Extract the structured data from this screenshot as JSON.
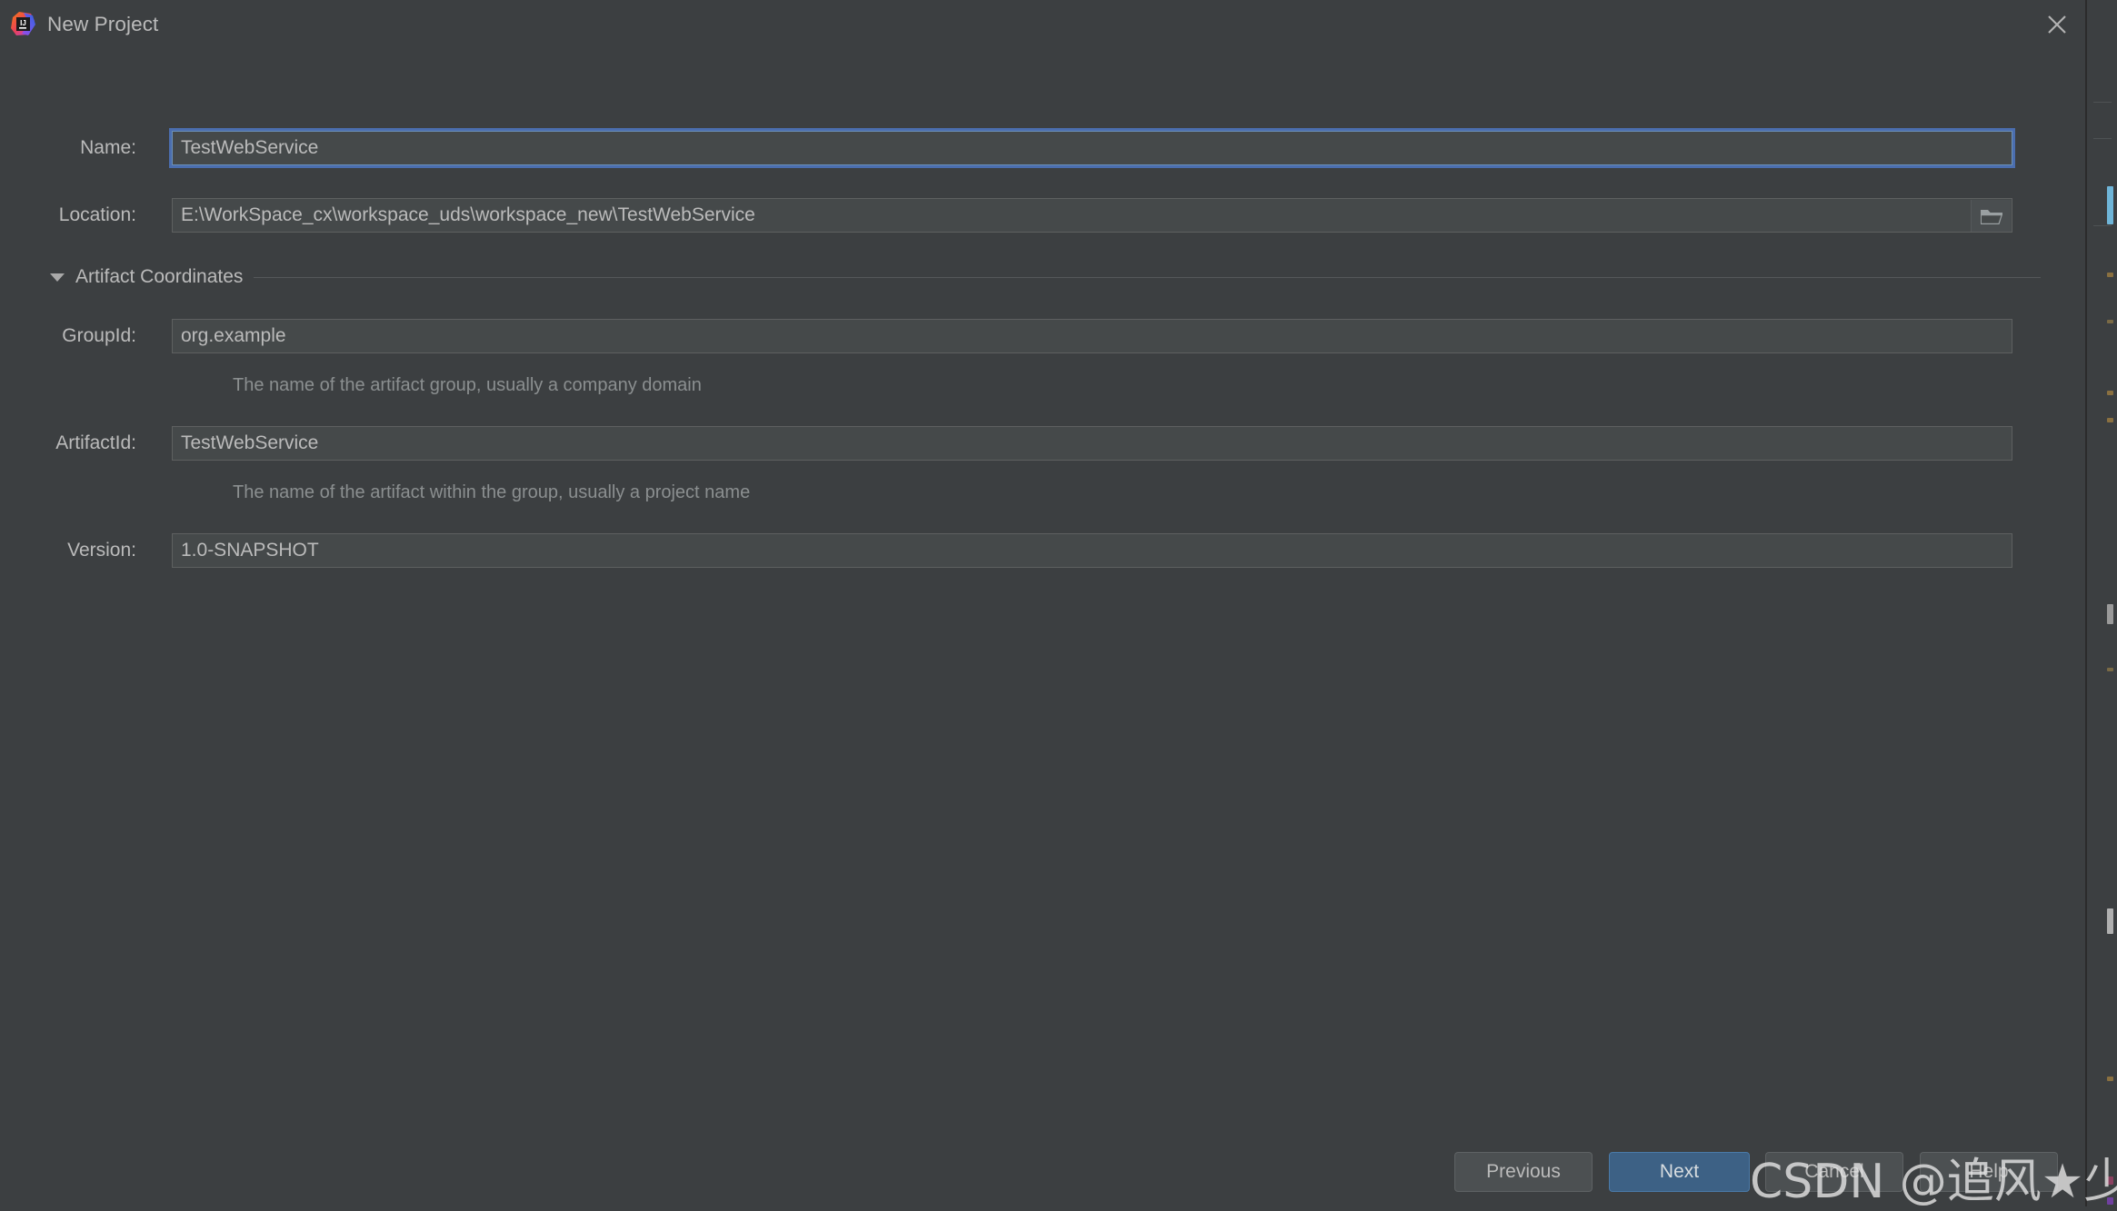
{
  "window": {
    "title": "New Project",
    "logo_icon": "intellij-idea-logo",
    "logo_text": "IJ",
    "close_icon": "close-icon"
  },
  "form": {
    "name": {
      "label": "Name:",
      "value": "TestWebService",
      "focused": true
    },
    "location": {
      "label": "Location:",
      "value": "E:\\WorkSpace_cx\\workspace_uds\\workspace_new\\TestWebService",
      "browse_icon": "folder-icon"
    },
    "artifact_section": {
      "title": "Artifact Coordinates",
      "expanded": true,
      "chevron_icon": "chevron-down-icon",
      "fields": [
        {
          "key": "group_id",
          "label": "GroupId:",
          "value": "org.example",
          "hint": "The name of the artifact group, usually a company domain"
        },
        {
          "key": "artifact_id",
          "label": "ArtifactId:",
          "value": "TestWebService",
          "hint": "The name of the artifact within the group, usually a project name"
        },
        {
          "key": "version",
          "label": "Version:",
          "value": "1.0-SNAPSHOT",
          "hint": ""
        }
      ]
    }
  },
  "footer": {
    "previous_label": "Previous",
    "next_label": "Next",
    "cancel_label": "Cancel",
    "help_label": "Help"
  },
  "watermark": {
    "text": "CSDN @追风★少年"
  },
  "colors": {
    "dialog_bg": "#3c3f41",
    "field_bg": "#45494a",
    "field_border": "#5e6060",
    "focus_border": "#4b6eaf",
    "text": "#bbbbbb",
    "hint_text": "#8b8f90",
    "primary_button": "#3d6185"
  }
}
